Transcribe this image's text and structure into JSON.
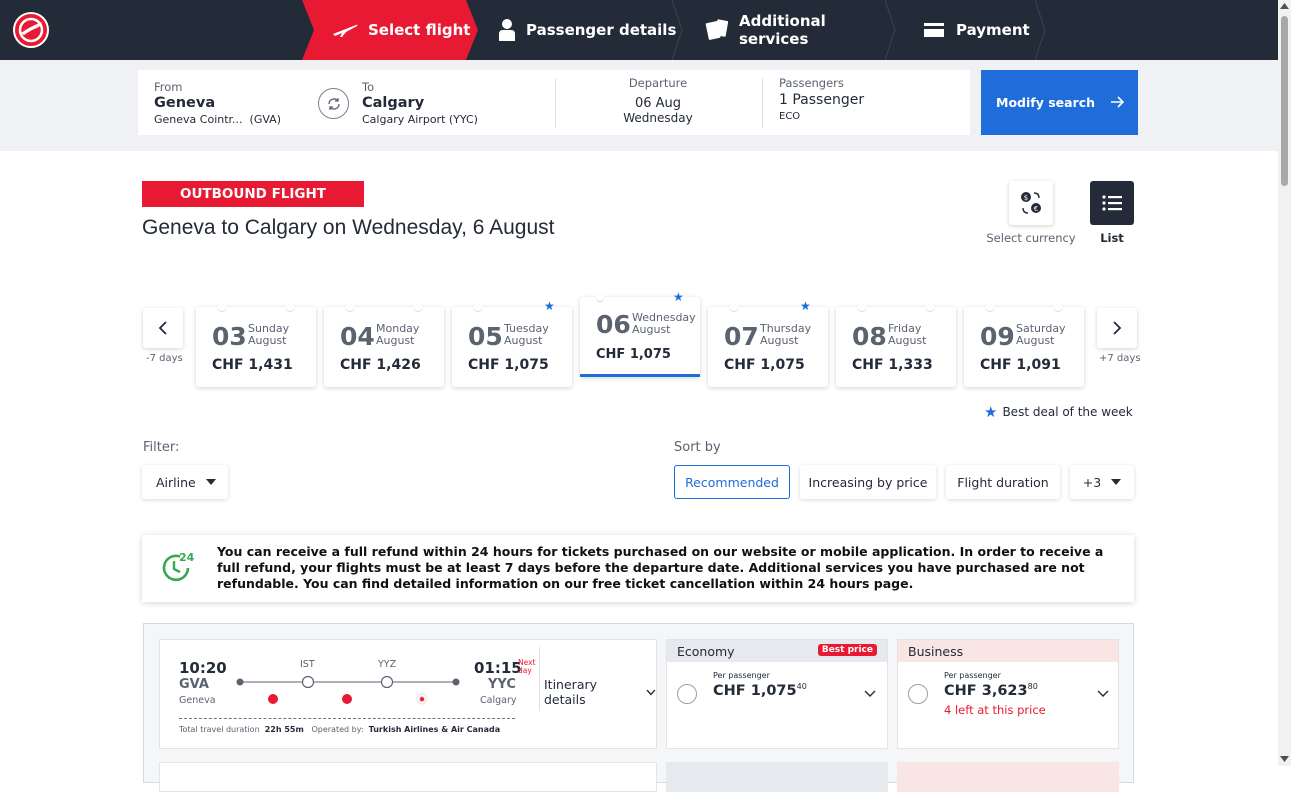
{
  "header": {
    "steps": [
      {
        "label": "Select flight",
        "icon": "plane-icon",
        "active": true
      },
      {
        "label": "Passenger details",
        "icon": "person-icon",
        "active": false
      },
      {
        "label": "Additional services",
        "icon": "services-icon",
        "active": false
      },
      {
        "label": "Payment",
        "icon": "card-icon",
        "active": false
      }
    ]
  },
  "search": {
    "from_label": "From",
    "from_city": "Geneva",
    "from_airport": "Geneva Cointr...",
    "from_code": "(GVA)",
    "to_label": "To",
    "to_city": "Calgary",
    "to_airport": "Calgary Airport (YYC)",
    "departure_label": "Departure",
    "departure_date": "06 Aug",
    "departure_day": "Wednesday",
    "passengers_label": "Passengers",
    "passengers_value": "1 Passenger",
    "cabin": "ECO",
    "modify_label": "Modify search"
  },
  "heading": {
    "badge": "OUTBOUND FLIGHT",
    "title": "Geneva to Calgary on Wednesday, 6 August",
    "currency_label": "Select currency",
    "list_label": "List"
  },
  "dates": {
    "prev_label": "-7 days",
    "next_label": "+7 days",
    "best_deal_label": "Best deal of the week",
    "items": [
      {
        "day": "03",
        "weekday": "Sunday",
        "month": "August",
        "price": "CHF 1,431",
        "best": false,
        "selected": false
      },
      {
        "day": "04",
        "weekday": "Monday",
        "month": "August",
        "price": "CHF 1,426",
        "best": false,
        "selected": false
      },
      {
        "day": "05",
        "weekday": "Tuesday",
        "month": "August",
        "price": "CHF 1,075",
        "best": true,
        "selected": false
      },
      {
        "day": "06",
        "weekday": "Wednesday",
        "month": "August",
        "price": "CHF 1,075",
        "best": true,
        "selected": true
      },
      {
        "day": "07",
        "weekday": "Thursday",
        "month": "August",
        "price": "CHF 1,075",
        "best": true,
        "selected": false
      },
      {
        "day": "08",
        "weekday": "Friday",
        "month": "August",
        "price": "CHF 1,333",
        "best": false,
        "selected": false
      },
      {
        "day": "09",
        "weekday": "Saturday",
        "month": "August",
        "price": "CHF 1,091",
        "best": false,
        "selected": false
      }
    ]
  },
  "filter": {
    "label": "Filter:",
    "airline": "Airline"
  },
  "sort": {
    "label": "Sort by",
    "options": [
      "Recommended",
      "Increasing by price",
      "Flight duration"
    ],
    "more": "+3",
    "selected": "Recommended"
  },
  "notice": {
    "badge": "24",
    "text": "You can receive a full refund within 24 hours for tickets purchased on our website or mobile application. In order to receive a full refund, your flights must be at least 7 days before the departure date. Additional services you have purchased are not refundable. You can find detailed information on our free ticket cancellation within 24 hours page."
  },
  "flight": {
    "dep_time": "10:20",
    "dep_code": "GVA",
    "dep_city": "Geneva",
    "arr_time": "01:15",
    "next_day": "Next day",
    "arr_code": "YYC",
    "arr_city": "Calgary",
    "stop1": "IST",
    "stop2": "YYZ",
    "itinerary_label": "Itinerary details",
    "total_label": "Total travel duration",
    "total_value": "22h 55m",
    "operated_label": "Operated by:",
    "operated_value": "Turkish Airlines & Air Canada"
  },
  "fares": {
    "economy": {
      "label": "Economy",
      "badge": "Best price",
      "per": "Per passenger",
      "price": "CHF 1,075",
      "cents": "40",
      "color": "#e6e9ee"
    },
    "business": {
      "label": "Business",
      "per": "Per passenger",
      "price": "CHF 3,623",
      "cents": "80",
      "left": "4 left at this price",
      "color": "#f9e5e4"
    }
  },
  "colors": {
    "brand_red": "#e81932",
    "navy": "#232b38",
    "accent_blue": "#1f6cdb"
  }
}
